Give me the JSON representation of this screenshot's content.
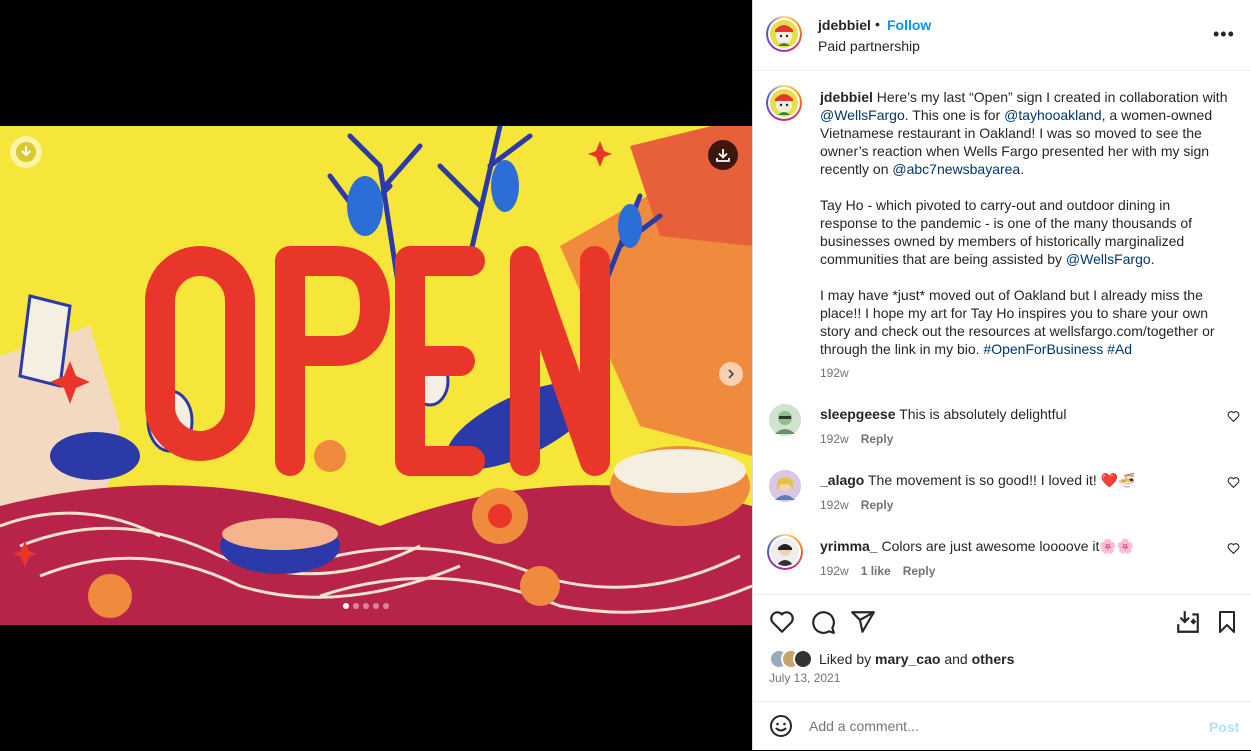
{
  "post": {
    "username": "jdebbiel",
    "separator": "•",
    "follow_label": "Follow",
    "subtitle": "Paid partnership",
    "more_label": "•••"
  },
  "artwork": {
    "sign_text": "OPEN",
    "colors": {
      "background": "#f7e63a",
      "letters": "#e8372a",
      "blue": "#2b3aa8",
      "orange": "#f08a3c"
    },
    "carousel_slide": 1,
    "carousel_total": 5
  },
  "caption": {
    "username": "jdebbiel",
    "p1_a": "Here’s my last “Open” sign I created in collaboration with ",
    "m_wellsfargo": "@WellsFargo",
    "p1_b": ". This one is for ",
    "m_tayho": "@tayhooakland",
    "p1_c": ", a women-owned Vietnamese restaurant in Oakland! I was so moved to see the owner’s reaction when Wells Fargo presented her with my sign recently on ",
    "m_abc7": "@abc7newsbayarea",
    "p1_d": ".",
    "p2_a": "Tay Ho - which pivoted to carry-out and outdoor dining in response to the pandemic - is one of the many thousands of businesses owned by members of historically marginalized communities that are being assisted by ",
    "m_wellsfargo2": "@WellsFargo",
    "p2_b": ".",
    "p3_a": "I may have *just* moved out of Oakland but I already miss the place!! I hope my art for Tay Ho inspires you to share your own story and check out the resources at wellsfargo.com/together or through the link in my bio. ",
    "h_open": "#OpenForBusiness",
    "h_ad": "#Ad",
    "time": "192w"
  },
  "comments": [
    {
      "username": "sleepgeese",
      "text": "This is absolutely delightful",
      "time": "192w",
      "likes": "",
      "reply": "Reply"
    },
    {
      "username": "_alago",
      "text": "The movement is so good!! I loved it! ❤️🍜",
      "time": "192w",
      "likes": "",
      "reply": "Reply"
    },
    {
      "username": "yrimma_",
      "text": "Colors are just awesome loooove it🌸🌸",
      "time": "192w",
      "likes": "1 like",
      "reply": "Reply"
    }
  ],
  "likes": {
    "prefix": "Liked by ",
    "user": "mary_cao",
    "and": " and ",
    "others": "others"
  },
  "date": "July 13, 2021",
  "add_comment": {
    "placeholder": "Add a comment...",
    "post_label": "Post"
  }
}
